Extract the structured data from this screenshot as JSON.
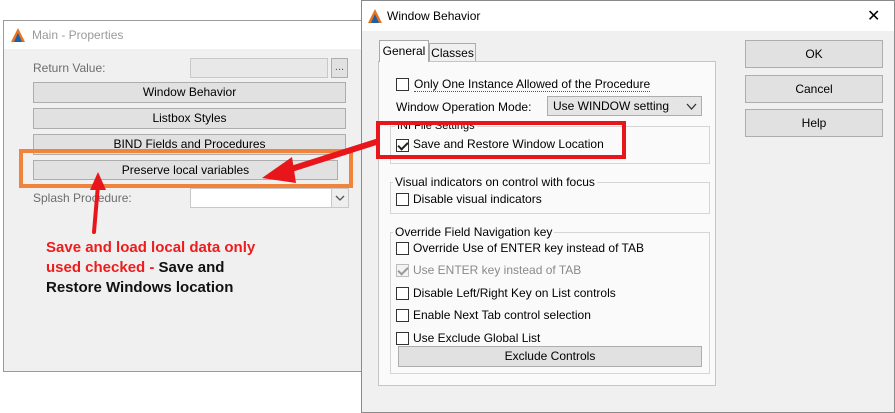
{
  "main_window": {
    "title": "Main - Properties",
    "return_value_label": "Return Value:",
    "ellipsis_label": "...",
    "buttons": {
      "window_behavior": "Window Behavior",
      "listbox_styles": "Listbox Styles",
      "bind_fields": "BIND Fields and Procedures",
      "preserve_local": "Preserve local variables"
    },
    "splash_label": "Splash Procedure:"
  },
  "dialog": {
    "title": "Window Behavior",
    "close_glyph": "✕",
    "tabs": [
      "General",
      "Classes"
    ],
    "only_one_instance": "Only One Instance Allowed of the Procedure",
    "operation_mode_label": "Window Operation Mode:",
    "operation_mode_value": "Use WINDOW setting",
    "ini_group_title": "INI File Settings",
    "save_restore_label": "Save and Restore Window Location",
    "visual_group_title": "Visual indicators on control with focus",
    "disable_visual_label": "Disable visual indicators",
    "override_group_title": "Override Field Navigation key",
    "override_enter_label": "Override Use of ENTER key instead of TAB",
    "use_enter_label": "Use ENTER key instead of TAB",
    "disable_lr_label": "Disable Left/Right Key on List controls",
    "enable_next_tab_label": "Enable Next Tab control selection",
    "use_exclude_label": "Use Exclude Global List",
    "exclude_controls_label": "Exclude Controls",
    "ok_label": "OK",
    "cancel_label": "Cancel",
    "help_label": "Help"
  },
  "annotation": {
    "line1": "Save and load local data only",
    "line2_red": "used checked - ",
    "line2_dark": "Save and",
    "line3_dark": "Restore Windows location"
  },
  "colors": {
    "highlight_red": "#e8161a",
    "highlight_orange": "#f0843c",
    "logo_orange": "#e8731c",
    "logo_blue": "#1d5fa8"
  }
}
